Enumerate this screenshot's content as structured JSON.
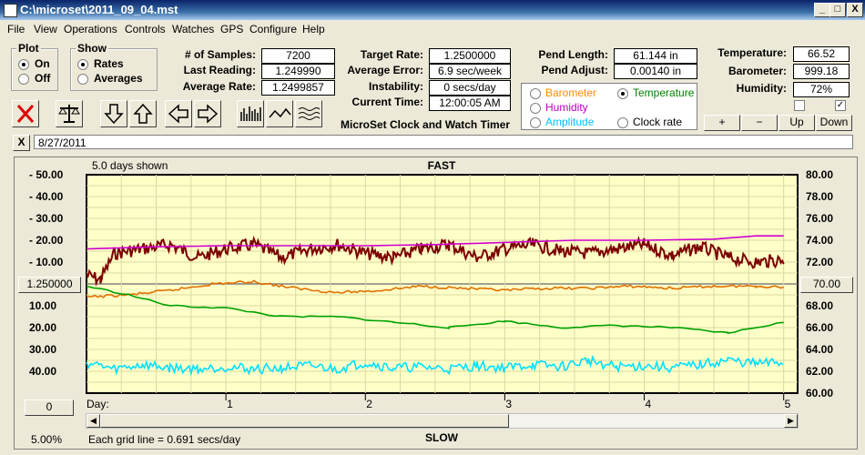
{
  "window": {
    "title": "C:\\microset\\2011_09_04.mst",
    "min": "_",
    "max": "□",
    "close": "X"
  },
  "menu": [
    "File",
    "View",
    "Operations",
    "Controls",
    "Watches",
    "GPS",
    "Configure",
    "Help"
  ],
  "plot_group": {
    "title": "Plot",
    "options": [
      "On",
      "Off"
    ],
    "selected": "On"
  },
  "show_group": {
    "title": "Show",
    "options": [
      "Rates",
      "Averages"
    ],
    "selected": "Rates"
  },
  "stats1": {
    "samples_label": "# of Samples:",
    "samples": "7200",
    "last_label": "Last Reading:",
    "last": "1.249990",
    "avg_label": "Average Rate:",
    "avg": "1.2499857"
  },
  "stats2": {
    "target_label": "Target Rate:",
    "target": "1.2500000",
    "err_label": "Average Error:",
    "err": "6.9 sec/week",
    "instab_label": "Instability:",
    "instab": "0 secs/day",
    "time_label": "Current Time:",
    "time": "12:00:05 AM"
  },
  "app_name": "MicroSet Clock and Watch Timer",
  "pend": {
    "length_label": "Pend Length:",
    "length": "61.144 in",
    "adjust_label": "Pend Adjust:",
    "adjust": "0.00140 in"
  },
  "sensor_options": [
    {
      "label": "Barometer",
      "color": "#ff8c00",
      "selected": false
    },
    {
      "label": "Temperature",
      "color": "#008000",
      "selected": true
    },
    {
      "label": "Humidity",
      "color": "#c000c0",
      "selected": false
    },
    {
      "label": "Clock rate",
      "color": "#000000",
      "selected": false
    },
    {
      "label": "Amplitude",
      "color": "#00c0ff",
      "selected": false
    }
  ],
  "env": {
    "temp_label": "Temperature:",
    "temp": "66.52",
    "baro_label": "Barometer:",
    "baro": "999.18",
    "hum_label": "Humidity:",
    "hum": "72%"
  },
  "zoom_buttons": [
    "+",
    "−",
    "Up",
    "Down"
  ],
  "note": {
    "close": "X",
    "text": "8/27/2011"
  },
  "chart_info": {
    "days_shown": "5.0 days shown",
    "fast": "FAST",
    "slow": "SLOW",
    "left_center": "1.250000",
    "right_center": "70.00",
    "bottom_left_btn": "0",
    "day_label": "Day:",
    "percent": "5.00%",
    "grid_note": "Each grid line = 0.691 secs/day"
  },
  "chart_data": {
    "type": "line",
    "x_unit": "days",
    "xlim": [
      0,
      5.1
    ],
    "x_ticks": [
      "1",
      "2",
      "3",
      "4",
      "5"
    ],
    "left_ticks": [
      "- 50.00",
      "- 40.00",
      "- 30.00",
      "- 20.00",
      "- 10.00",
      "10.00",
      "20.00",
      "30.00",
      "40.00"
    ],
    "right_ticks": [
      "80.00",
      "78.00",
      "76.00",
      "74.00",
      "72.00",
      "68.00",
      "66.00",
      "64.00",
      "62.00",
      "60.00"
    ],
    "left_ylim": [
      -50,
      50
    ],
    "right_ylim": [
      60,
      80
    ],
    "series": [
      {
        "color": "#7b0000",
        "x": [
          0,
          0.1,
          0.2,
          0.4,
          0.6,
          0.8,
          1,
          1.2,
          1.4,
          1.6,
          1.8,
          2,
          2.2,
          2.4,
          2.6,
          2.8,
          3,
          3.2,
          3.4,
          3.6,
          3.8,
          4,
          4.2,
          4.4,
          4.6,
          4.8,
          5
        ],
        "y": [
          -4,
          -2,
          -14,
          -16,
          -18,
          -12,
          -16,
          -18,
          -12,
          -16,
          -18,
          -14,
          -12,
          -16,
          -18,
          -12,
          -16,
          -18,
          -15,
          -14,
          -16,
          -18,
          -13,
          -17,
          -12,
          -10,
          -11
        ]
      },
      {
        "color": "#e07000",
        "x": [
          0,
          0.3,
          0.6,
          0.9,
          1.2,
          1.5,
          1.8,
          2.1,
          2.4,
          2.7,
          3,
          3.3,
          3.6,
          3.9,
          4.2,
          4.5,
          4.8,
          5
        ],
        "y": [
          6,
          5,
          3,
          0,
          -1,
          2,
          4,
          3,
          1,
          2,
          3,
          2,
          2,
          1,
          2,
          1,
          1,
          1.5
        ]
      },
      {
        "color": "#00a000",
        "x": [
          0,
          0.3,
          0.6,
          1,
          1.4,
          1.8,
          2.2,
          2.6,
          3,
          3.4,
          3.8,
          4.2,
          4.6,
          5
        ],
        "y": [
          69.8,
          69,
          68,
          67.8,
          67,
          67,
          66.5,
          66,
          66.6,
          66,
          66.2,
          66,
          65.5,
          66.5
        ]
      },
      {
        "color": "#d000d0",
        "x": [
          0,
          0.5,
          1,
          1.5,
          2,
          2.5,
          3,
          3.5,
          4,
          4.5,
          4.8,
          5
        ],
        "y": [
          73.2,
          73.4,
          73.5,
          73.5,
          73.5,
          73.6,
          73.8,
          74,
          74,
          74.1,
          74.4,
          74.4
        ]
      },
      {
        "color": "#00e0ff",
        "x": [
          0,
          0.2,
          0.4,
          0.6,
          0.8,
          1,
          1.2,
          1.4,
          1.6,
          1.8,
          2,
          2.2,
          2.4,
          2.6,
          2.8,
          3,
          3.2,
          3.4,
          3.6,
          3.8,
          4,
          4.2,
          4.4,
          4.6,
          4.8,
          5
        ],
        "y": [
          62.8,
          62.2,
          62.6,
          62.3,
          62.2,
          62.4,
          62.2,
          62.3,
          62.5,
          62.2,
          62.8,
          62.3,
          62.4,
          62.2,
          62.5,
          62.3,
          62.6,
          62.4,
          63,
          62.4,
          62.5,
          62.3,
          62.6,
          63,
          62.7,
          62.8
        ]
      }
    ]
  }
}
